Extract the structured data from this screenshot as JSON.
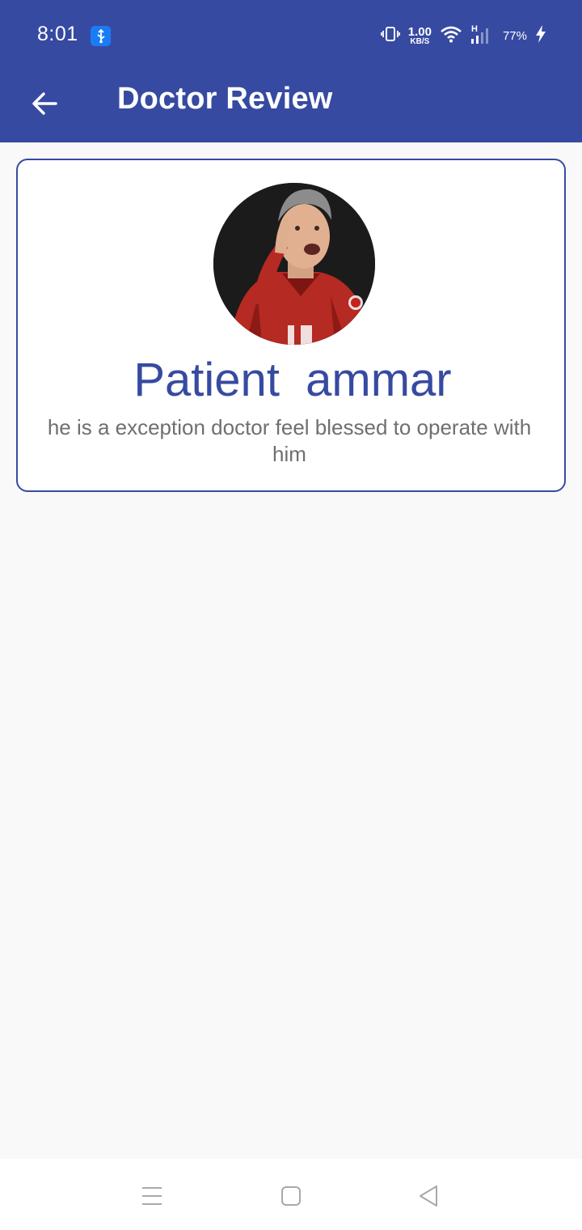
{
  "status_bar": {
    "time": "8:01",
    "net_speed_value": "1.00",
    "net_speed_unit": "KB/S",
    "signal_type": "H",
    "battery": "77%",
    "icons": [
      "usb-icon",
      "vibrate-icon",
      "wifi-icon",
      "signal-icon",
      "charging-icon"
    ]
  },
  "app_bar": {
    "title": "Doctor Review",
    "back_icon": "arrow-back-icon"
  },
  "review": {
    "patient_name": "Patient  ammar",
    "text": "he is a exception doctor feel blessed to operate with him"
  },
  "nav_bar": {
    "icons": [
      "menu-icon",
      "home-icon",
      "back-triangle-icon"
    ]
  },
  "colors": {
    "primary": "#374aa1",
    "background": "#f9f9f9",
    "text_secondary": "#6f6f6f"
  }
}
